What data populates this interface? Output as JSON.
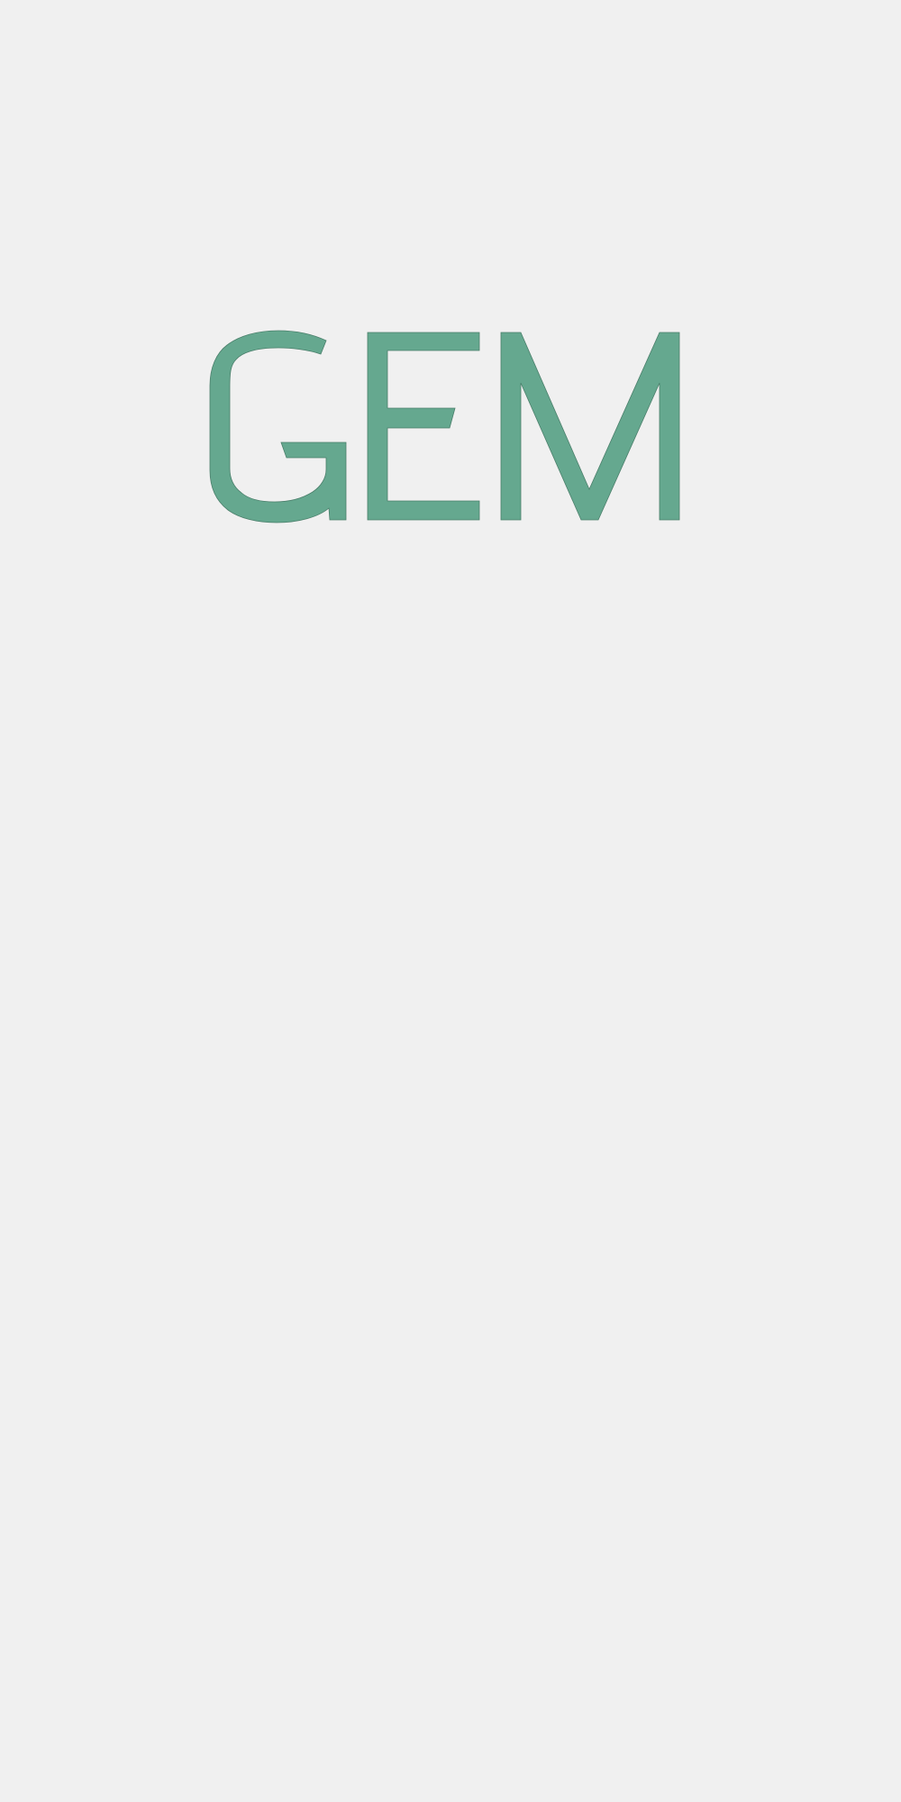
{
  "splash": {
    "logo_text": "GEM",
    "logo_color": "#65a88f",
    "background_color": "#f0f0f0"
  }
}
